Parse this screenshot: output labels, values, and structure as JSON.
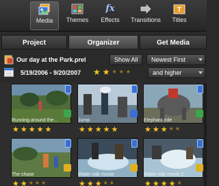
{
  "toolbar": {
    "items": [
      {
        "label": "Media",
        "icon": "media-icon",
        "active": true
      },
      {
        "label": "Themes",
        "icon": "themes-icon",
        "active": false
      },
      {
        "label": "Effects",
        "icon": "effects-icon",
        "glyph": "fx",
        "active": false
      },
      {
        "label": "Transitions",
        "icon": "transitions-icon",
        "active": false
      },
      {
        "label": "Titles",
        "icon": "titles-icon",
        "active": false
      }
    ]
  },
  "tabs": [
    {
      "label": "Project",
      "active": false
    },
    {
      "label": "Organizer",
      "active": true
    },
    {
      "label": "Get Media",
      "active": false
    }
  ],
  "project": {
    "title": "Our day at the Park.prel",
    "show_all": "Show All",
    "sort": "Newest First"
  },
  "filter": {
    "date_range": "5/19/2006 - 9/20/2007",
    "rating": 2,
    "max_rating": 5,
    "rating_mode": "and higher"
  },
  "clips": [
    {
      "title": "Running around the...",
      "rating": 5,
      "badge": "green"
    },
    {
      "title": "Jump",
      "rating": 5,
      "badge": "blue"
    },
    {
      "title": "Elephant ride",
      "rating": 3,
      "badge": "green"
    },
    {
      "title": "The chase",
      "rating": 2,
      "badge": "yellow"
    },
    {
      "title": "Water ride movie",
      "rating": 3,
      "badge": "yellow"
    },
    {
      "title": "Water ride movie 2",
      "rating": 4,
      "badge": "yellow"
    }
  ],
  "colors": {
    "star": "#f7c427",
    "star_dim": "#9a7a25",
    "badge_blue": "#3a6fd0",
    "badge_green": "#3aa84a",
    "badge_yellow": "#e0b020"
  }
}
